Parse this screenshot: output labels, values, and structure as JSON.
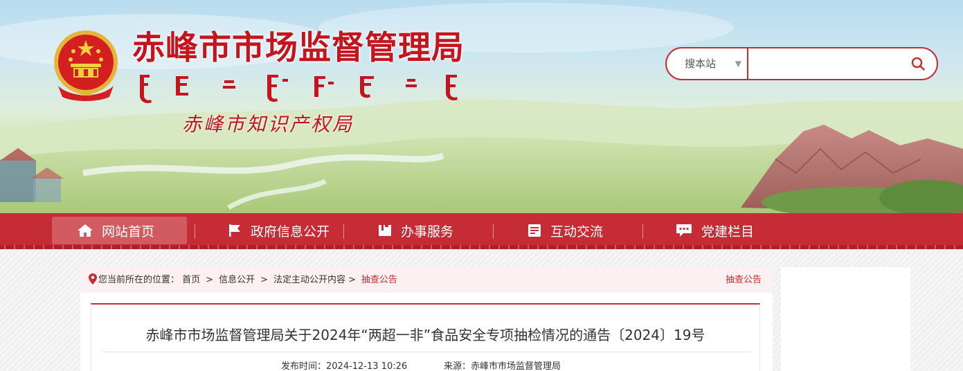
{
  "header": {
    "title": "赤峰市市场监督管理局",
    "subtitle": "赤峰市知识产权局"
  },
  "search": {
    "scope_label": "搜本站",
    "placeholder": ""
  },
  "nav": {
    "items": [
      {
        "label": "网站首页",
        "icon": "home-icon"
      },
      {
        "label": "政府信息公开",
        "icon": "flag-icon"
      },
      {
        "label": "办事服务",
        "icon": "service-icon"
      },
      {
        "label": "互动交流",
        "icon": "interaction-icon"
      },
      {
        "label": "党建栏目",
        "icon": "chat-icon"
      }
    ]
  },
  "breadcrumb": {
    "prefix": "您当前所在的位置：",
    "items": [
      "首页",
      "信息公开",
      "法定主动公开内容",
      "抽查公告"
    ],
    "section": "抽查公告"
  },
  "article": {
    "title": "赤峰市市场监督管理局关于2024年“两超一非”食品安全专项抽检情况的通告〔2024〕19号",
    "publish_time": "发布时间：2024-12-13 10:26",
    "source": "来源：赤峰市市场监督管理局"
  },
  "colors": {
    "brand_red": "#c62c35",
    "title_red": "#c4141e"
  }
}
